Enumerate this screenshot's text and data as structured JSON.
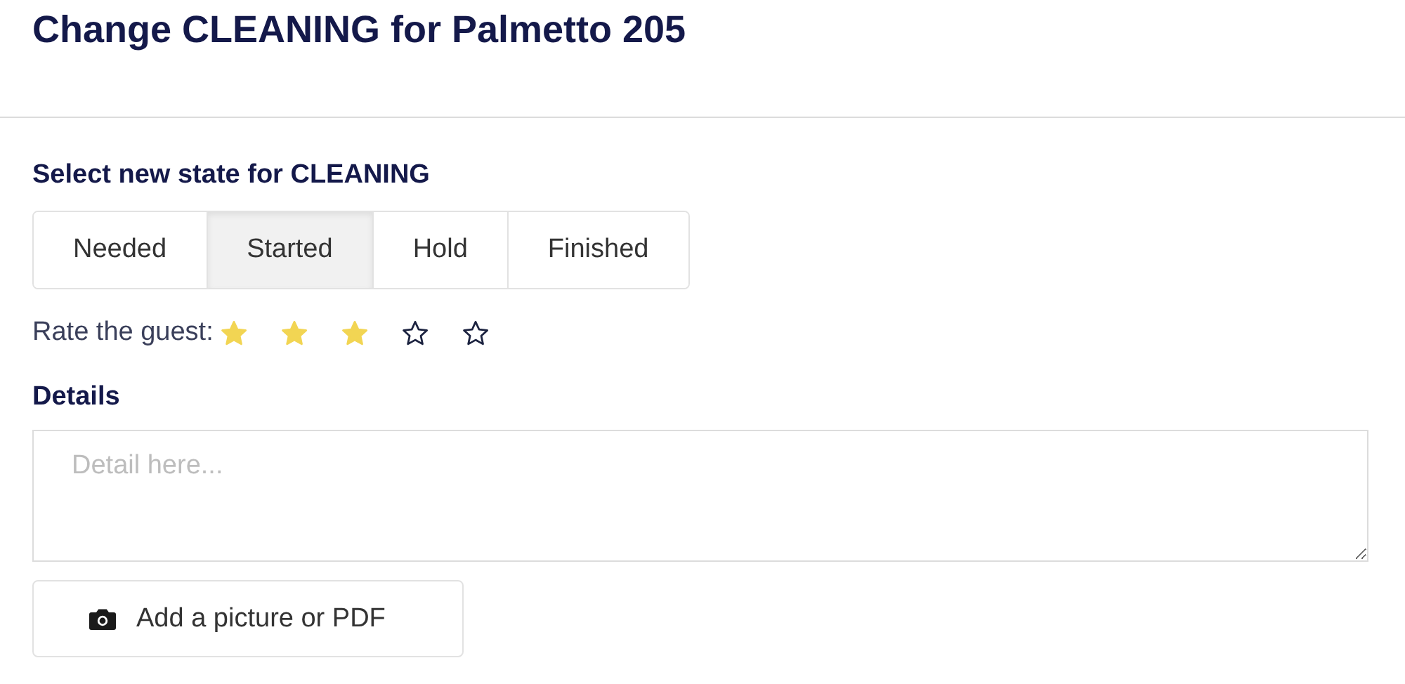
{
  "title": "Change CLEANING for Palmetto 205",
  "state_label": "Select new state for CLEANING",
  "states": [
    {
      "label": "Needed",
      "selected": false
    },
    {
      "label": "Started",
      "selected": true
    },
    {
      "label": "Hold",
      "selected": false
    },
    {
      "label": "Finished",
      "selected": false
    }
  ],
  "rating": {
    "label": "Rate the guest:",
    "stars": 3
  },
  "details": {
    "label": "Details",
    "placeholder": "Detail here..."
  },
  "upload_button": "Add a picture or PDF"
}
